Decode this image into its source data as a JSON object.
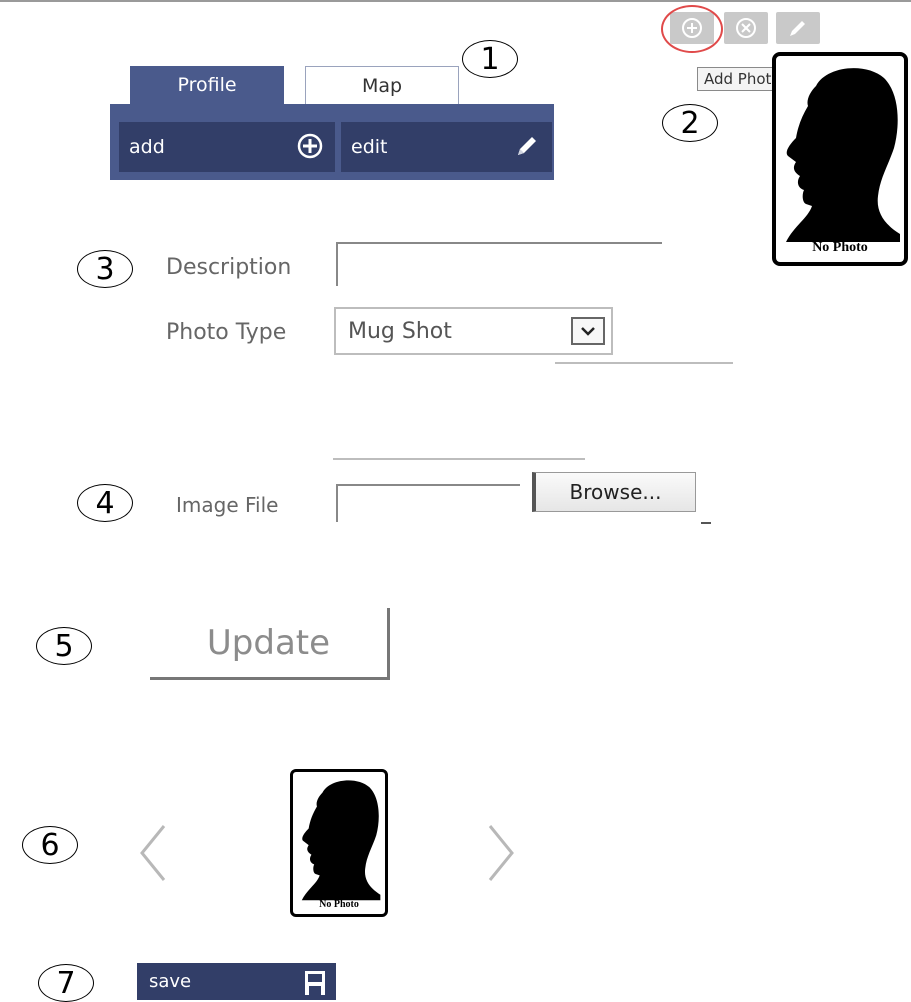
{
  "steps": [
    "1",
    "2",
    "3",
    "4",
    "5",
    "6",
    "7"
  ],
  "tabs": [
    {
      "label": "Profile"
    },
    {
      "label": "Map"
    }
  ],
  "toolbar": {
    "add_label": "add",
    "edit_label": "edit"
  },
  "photo_header": {
    "tooltip": "Add Photo",
    "icons": [
      "add-circle-icon",
      "delete-circle-icon",
      "pencil-icon"
    ]
  },
  "photo": {
    "placeholder_text": "No Photo"
  },
  "form": {
    "description_label": "Description",
    "description_value": "",
    "photo_type_label": "Photo Type",
    "photo_type_value": "Mug Shot",
    "image_file_label": "Image File",
    "image_file_value": "",
    "browse_label": "Browse...",
    "update_label": "Update"
  },
  "carousel": {
    "thumb_text": "No Photo"
  },
  "footer": {
    "save_label": "save"
  },
  "colors": {
    "accent": "#4a5a8c",
    "button_dark": "#323e68",
    "highlight": "#e04a4a"
  }
}
